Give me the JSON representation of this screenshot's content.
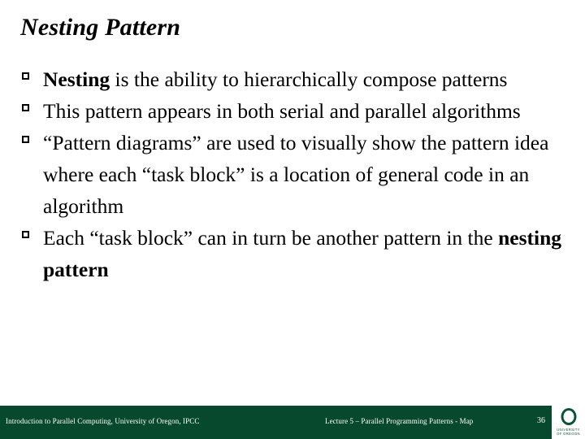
{
  "slide": {
    "title": "Nesting Pattern",
    "bullets": [
      {
        "marker": "hollow-square-bullet",
        "segments": [
          {
            "text": "Nesting",
            "bold": true
          },
          {
            "text": " is the ability to hierarchically compose patterns",
            "bold": false
          }
        ]
      },
      {
        "marker": "hollow-square-bullet",
        "segments": [
          {
            "text": "This pattern appears in both serial and parallel algorithms",
            "bold": false
          }
        ]
      },
      {
        "marker": "hollow-square-bullet",
        "segments": [
          {
            "text": "“Pattern diagrams” are used to visually show the pattern idea where each “task block” is a location of general code in an algorithm",
            "bold": false
          }
        ]
      },
      {
        "marker": "hollow-square-bullet",
        "segments": [
          {
            "text": "Each “task block” can in turn be another pattern in the ",
            "bold": false
          },
          {
            "text": "nesting pattern",
            "bold": true
          }
        ]
      }
    ]
  },
  "footer": {
    "left_text": "Introduction to Parallel Computing, University of Oregon, IPCC",
    "center_text": "Lecture 5 – Parallel Programming Patterns - Map",
    "page_number": "36",
    "background_color": "#07492C",
    "text_color": "#FFFFFF"
  },
  "logo": {
    "mark": "O",
    "line1": "UNIVERSITY",
    "line2": "OF OREGON",
    "color": "#0B5237",
    "background_color": "#FFFFFF"
  }
}
